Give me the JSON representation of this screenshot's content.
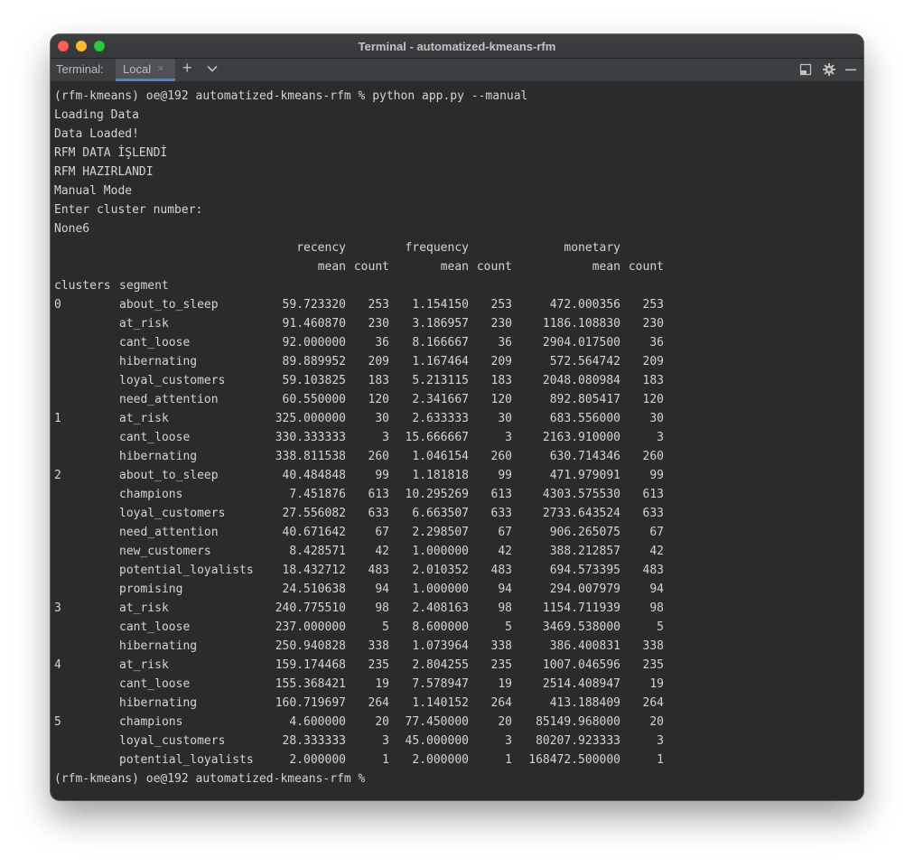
{
  "window": {
    "title": "Terminal - automatized-kmeans-rfm"
  },
  "tabbar": {
    "label": "Terminal:",
    "active_tab": "Local",
    "close_glyph": "×",
    "new_tab_glyph": "+",
    "icons": [
      "chevron-down-icon",
      "minimize-panel-icon",
      "gear-icon",
      "hide-icon"
    ]
  },
  "colors": {
    "terminal_bg": "#2b2b2b",
    "text": "#d4d4d4",
    "tab_underline": "#4a88c7"
  },
  "output": {
    "command_line": "(rfm-kmeans) oe@192 automatized-kmeans-rfm % python app.py --manual",
    "lines": [
      "Loading Data",
      "Data Loaded!",
      "RFM DATA İŞLENDİ",
      "RFM HAZIRLANDI",
      "Manual Mode",
      "Enter cluster number:",
      "None6"
    ],
    "table": {
      "group_headers": [
        "recency",
        "frequency",
        "monetary"
      ],
      "sub_headers": [
        "mean",
        "count",
        "mean",
        "count",
        "mean",
        "count"
      ],
      "index_headers": [
        "clusters",
        "segment"
      ],
      "rows": [
        [
          "0",
          "about_to_sleep",
          "59.723320",
          "253",
          "1.154150",
          "253",
          "472.000356",
          "253"
        ],
        [
          "",
          "at_risk",
          "91.460870",
          "230",
          "3.186957",
          "230",
          "1186.108830",
          "230"
        ],
        [
          "",
          "cant_loose",
          "92.000000",
          "36",
          "8.166667",
          "36",
          "2904.017500",
          "36"
        ],
        [
          "",
          "hibernating",
          "89.889952",
          "209",
          "1.167464",
          "209",
          "572.564742",
          "209"
        ],
        [
          "",
          "loyal_customers",
          "59.103825",
          "183",
          "5.213115",
          "183",
          "2048.080984",
          "183"
        ],
        [
          "",
          "need_attention",
          "60.550000",
          "120",
          "2.341667",
          "120",
          "892.805417",
          "120"
        ],
        [
          "1",
          "at_risk",
          "325.000000",
          "30",
          "2.633333",
          "30",
          "683.556000",
          "30"
        ],
        [
          "",
          "cant_loose",
          "330.333333",
          "3",
          "15.666667",
          "3",
          "2163.910000",
          "3"
        ],
        [
          "",
          "hibernating",
          "338.811538",
          "260",
          "1.046154",
          "260",
          "630.714346",
          "260"
        ],
        [
          "2",
          "about_to_sleep",
          "40.484848",
          "99",
          "1.181818",
          "99",
          "471.979091",
          "99"
        ],
        [
          "",
          "champions",
          "7.451876",
          "613",
          "10.295269",
          "613",
          "4303.575530",
          "613"
        ],
        [
          "",
          "loyal_customers",
          "27.556082",
          "633",
          "6.663507",
          "633",
          "2733.643524",
          "633"
        ],
        [
          "",
          "need_attention",
          "40.671642",
          "67",
          "2.298507",
          "67",
          "906.265075",
          "67"
        ],
        [
          "",
          "new_customers",
          "8.428571",
          "42",
          "1.000000",
          "42",
          "388.212857",
          "42"
        ],
        [
          "",
          "potential_loyalists",
          "18.432712",
          "483",
          "2.010352",
          "483",
          "694.573395",
          "483"
        ],
        [
          "",
          "promising",
          "24.510638",
          "94",
          "1.000000",
          "94",
          "294.007979",
          "94"
        ],
        [
          "3",
          "at_risk",
          "240.775510",
          "98",
          "2.408163",
          "98",
          "1154.711939",
          "98"
        ],
        [
          "",
          "cant_loose",
          "237.000000",
          "5",
          "8.600000",
          "5",
          "3469.538000",
          "5"
        ],
        [
          "",
          "hibernating",
          "250.940828",
          "338",
          "1.073964",
          "338",
          "386.400831",
          "338"
        ],
        [
          "4",
          "at_risk",
          "159.174468",
          "235",
          "2.804255",
          "235",
          "1007.046596",
          "235"
        ],
        [
          "",
          "cant_loose",
          "155.368421",
          "19",
          "7.578947",
          "19",
          "2514.408947",
          "19"
        ],
        [
          "",
          "hibernating",
          "160.719697",
          "264",
          "1.140152",
          "264",
          "413.188409",
          "264"
        ],
        [
          "5",
          "champions",
          "4.600000",
          "20",
          "77.450000",
          "20",
          "85149.968000",
          "20"
        ],
        [
          "",
          "loyal_customers",
          "28.333333",
          "3",
          "45.000000",
          "3",
          "80207.923333",
          "3"
        ],
        [
          "",
          "potential_loyalists",
          "2.000000",
          "1",
          "2.000000",
          "1",
          "168472.500000",
          "1"
        ]
      ]
    },
    "prompt": "(rfm-kmeans) oe@192 automatized-kmeans-rfm % "
  }
}
